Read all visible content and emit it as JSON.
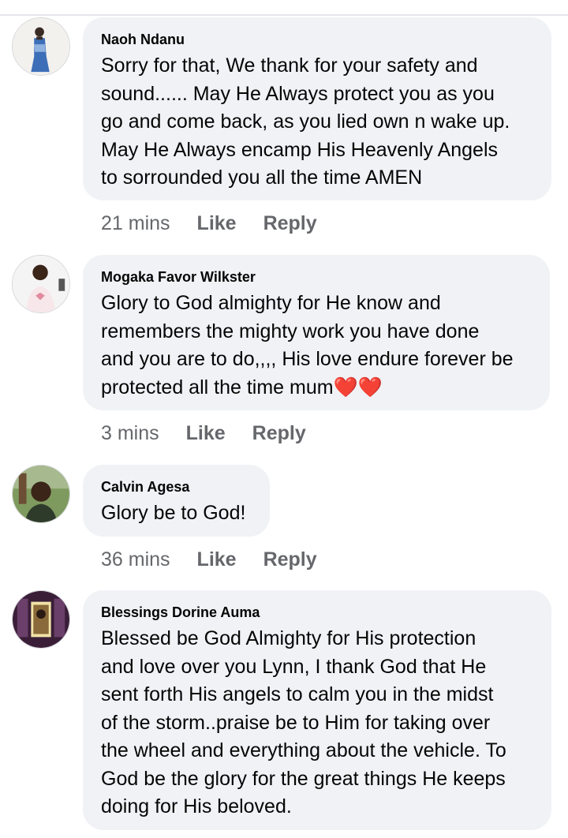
{
  "comments": [
    {
      "author": "Naoh Ndanu",
      "text": "Sorry for that, We thank for your safety and\nsound...... May He Always protect you as you\ngo and come back, as you lied own n wake up.\nMay He Always encamp His Heavenly Angels\nto sorrounded you all the time AMEN",
      "time": "21 mins",
      "like": "Like",
      "reply": "Reply"
    },
    {
      "author": "Mogaka Favor Wilkster",
      "text": "Glory to God almighty for He know and\nremembers the mighty work you have done\nand you are to do,,,, His love endure forever be\nprotected all the time mum",
      "emoji": "❤️❤️",
      "time": "3 mins",
      "like": "Like",
      "reply": "Reply"
    },
    {
      "author": "Calvin Agesa",
      "text": "Glory be to God!",
      "time": "36 mins",
      "like": "Like",
      "reply": "Reply"
    },
    {
      "author": "Blessings Dorine Auma",
      "text": "Blessed be God Almighty for His protection\nand love over you Lynn, I thank God that He\nsent forth His angels to calm you in the midst\nof the storm..praise be to Him for taking over\nthe wheel and everything about the vehicle. To\nGod be the glory for the great things He keeps\ndoing for His beloved.",
      "time": "",
      "like": "",
      "reply": ""
    }
  ]
}
